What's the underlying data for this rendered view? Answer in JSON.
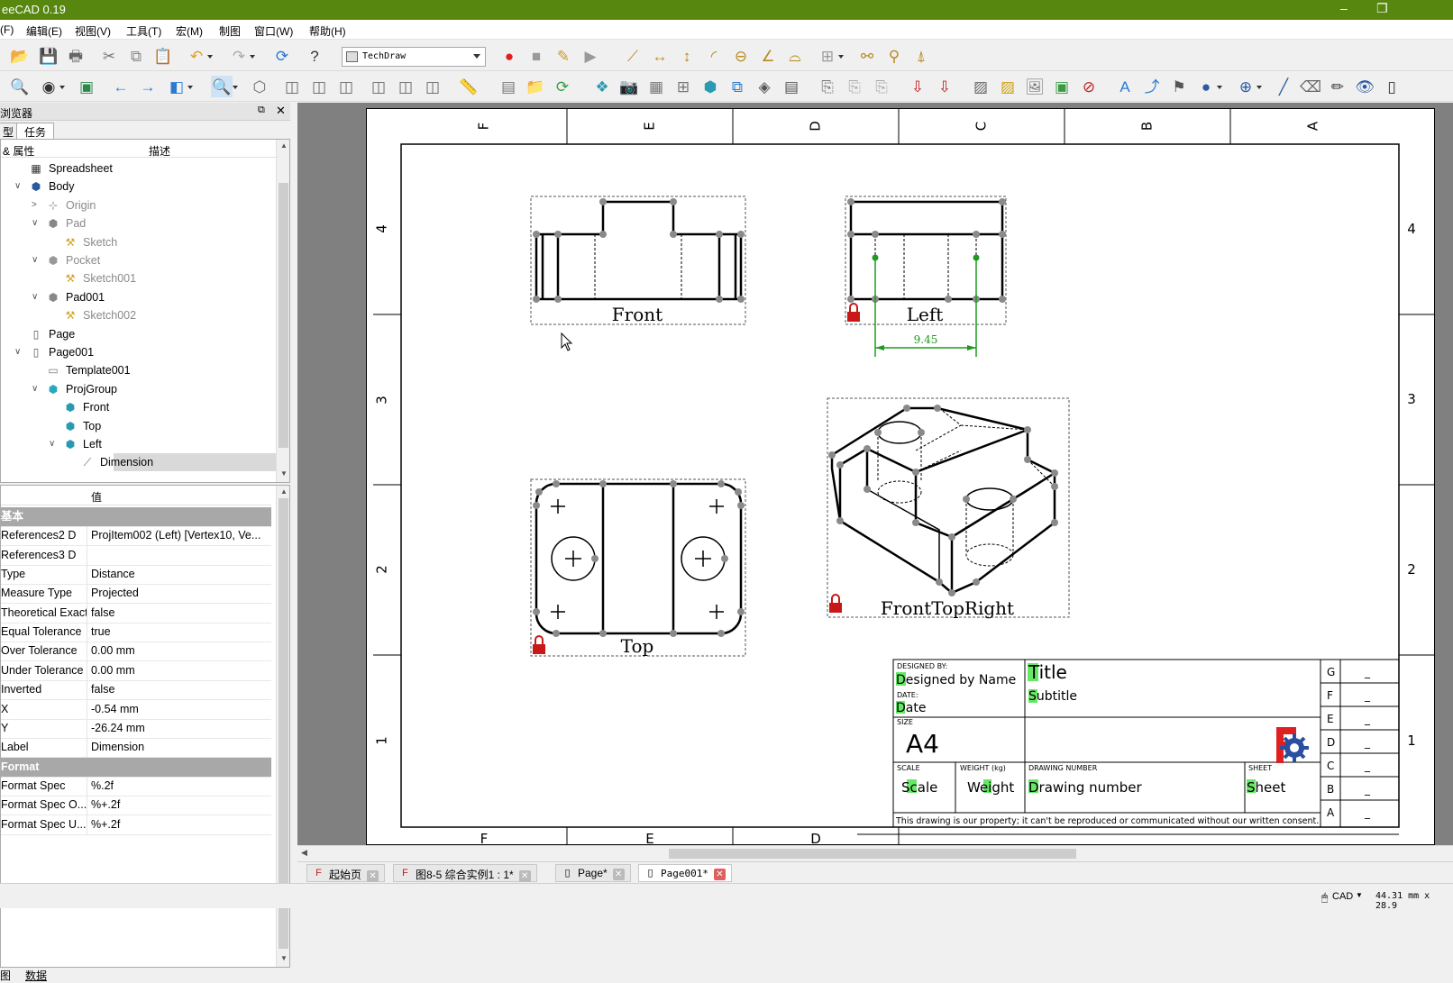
{
  "window": {
    "title": "eeCAD 0.19",
    "minimize": "–",
    "restore": "❐"
  },
  "menu": [
    "(F)",
    "编辑(E)",
    "视图(V)",
    "工具(T)",
    "宏(M)",
    "制图",
    "窗口(W)",
    "帮助(H)"
  ],
  "toolbar": {
    "workbench": "TechDraw"
  },
  "left_panel": {
    "title": "浏览器",
    "tabs": [
      "型",
      "任务"
    ],
    "tree_headers": {
      "name": "& 属性",
      "desc": "描述"
    },
    "tree": [
      {
        "label": "Spreadsheet",
        "icon": "spreadsheet-icon"
      },
      {
        "label": "Body",
        "icon": "body-icon",
        "expand": "∨"
      },
      {
        "label": "Origin",
        "icon": "origin-icon",
        "expand": ">",
        "muted": true
      },
      {
        "label": "Pad",
        "icon": "pad-icon",
        "expand": "∨",
        "muted": true
      },
      {
        "label": "Sketch",
        "icon": "sketch-icon",
        "muted": true
      },
      {
        "label": "Pocket",
        "icon": "pocket-icon",
        "expand": "∨",
        "muted": true
      },
      {
        "label": "Sketch001",
        "icon": "sketch-icon",
        "muted": true
      },
      {
        "label": "Pad001",
        "icon": "pad-icon",
        "expand": "∨"
      },
      {
        "label": "Sketch002",
        "icon": "sketch-icon",
        "muted": true
      },
      {
        "label": "Page",
        "icon": "page-icon"
      },
      {
        "label": "Page001",
        "icon": "page-icon",
        "expand": "∨"
      },
      {
        "label": "Template001",
        "icon": "template-icon"
      },
      {
        "label": "ProjGroup",
        "icon": "projgroup-icon",
        "expand": "∨"
      },
      {
        "label": "Front",
        "icon": "view-icon"
      },
      {
        "label": "Top",
        "icon": "view-icon"
      },
      {
        "label": "Left",
        "icon": "view-icon",
        "expand": "∨"
      },
      {
        "label": "Dimension",
        "icon": "dimension-icon",
        "selected": true
      }
    ],
    "prop_headers": {
      "name": "",
      "value": "值"
    },
    "properties": [
      {
        "group": "基本"
      },
      {
        "name": "References2 D",
        "value": "ProjItem002 (Left) [Vertex10, Ve..."
      },
      {
        "name": "References3 D",
        "value": ""
      },
      {
        "name": "Type",
        "value": "Distance"
      },
      {
        "name": "Measure Type",
        "value": "Projected"
      },
      {
        "name": "Theoretical Exact",
        "value": "false"
      },
      {
        "name": "Equal Tolerance",
        "value": "true"
      },
      {
        "name": "Over Tolerance",
        "value": "0.00 mm"
      },
      {
        "name": "Under Tolerance",
        "value": "0.00 mm"
      },
      {
        "name": "Inverted",
        "value": "false"
      },
      {
        "name": "X",
        "value": "-0.54 mm"
      },
      {
        "name": "Y",
        "value": "-26.24 mm"
      },
      {
        "name": "Label",
        "value": "Dimension"
      },
      {
        "group": "Format"
      },
      {
        "name": "Format Spec",
        "value": "%.2f"
      },
      {
        "name": "Format Spec O...",
        "value": "%+.2f"
      },
      {
        "name": "Format Spec U...",
        "value": "%+.2f"
      }
    ],
    "bottom_tabs": [
      "图",
      "数据"
    ]
  },
  "drawing": {
    "col_labels": [
      "F",
      "E",
      "D",
      "C",
      "B",
      "A"
    ],
    "row_labels": [
      "4",
      "3",
      "2",
      "1"
    ],
    "views": {
      "front": "Front",
      "left": "Left",
      "top": "Top",
      "iso": "FrontTopRight"
    },
    "dimension_value": "9.45",
    "title_block": {
      "designed_by_label": "DESIGNED BY:",
      "designed_by": "Designed by Name",
      "date_label": "DATE:",
      "date": "Date",
      "size_label": "SIZE",
      "size": "A4",
      "scale_label": "SCALE",
      "scale": "Scale",
      "weight_label": "WEIGHT (kg)",
      "weight": "Weight",
      "drawing_number_label": "DRAWING NUMBER",
      "drawing_number": "Drawing number",
      "sheet_label": "SHEET",
      "sheet": "Sheet",
      "title": "Title",
      "subtitle": "Subtitle",
      "disclaimer": "This drawing is our property; it can't be reproduced or communicated without our written consent.",
      "revisions": [
        "G",
        "F",
        "E",
        "D",
        "C",
        "B",
        "A"
      ],
      "rev_value": "_"
    }
  },
  "doc_tabs": [
    {
      "label": "起始页",
      "active": false
    },
    {
      "label": "图8-5 综合实例1 : 1*",
      "active": false
    },
    {
      "label": "Page*",
      "active": false
    },
    {
      "label": "Page001*",
      "active": true
    }
  ],
  "status": {
    "nav": "CAD",
    "coords": "44.31 mm x 28.9"
  }
}
